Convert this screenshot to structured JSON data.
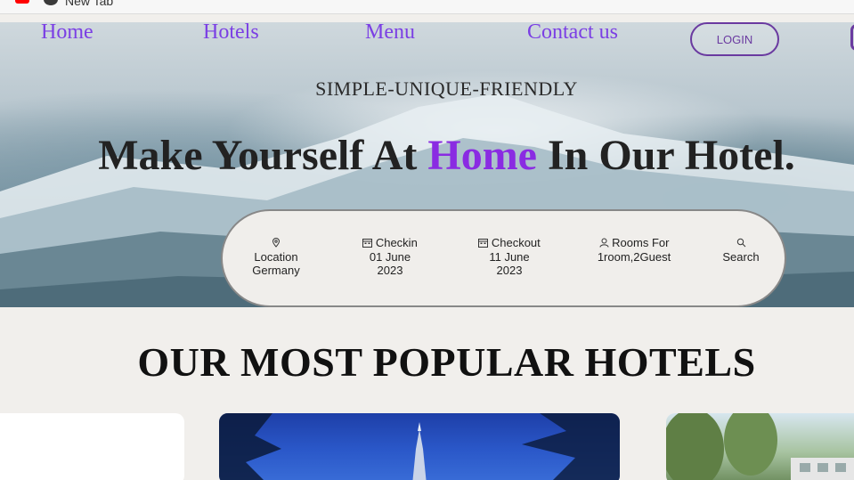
{
  "browser": {
    "tab_title": "New Tab"
  },
  "nav": {
    "links": [
      "Home",
      "Hotels",
      "Menu",
      "Contact us"
    ],
    "login_label": "LOGIN"
  },
  "hero": {
    "tagline": "SIMPLE-UNIQUE-FRIENDLY",
    "headline_before": "Make Yourself At ",
    "headline_accent": "Home",
    "headline_after": " In Our Hotel."
  },
  "search": {
    "location": {
      "label": "Location",
      "value": "Germany",
      "icon": "location-pin-icon"
    },
    "checkin": {
      "label": "Checkin",
      "date": "01 June",
      "year": "2023",
      "icon": "calendar-icon"
    },
    "checkout": {
      "label": "Checkout",
      "date": "11 June",
      "year": "2023",
      "icon": "calendar-icon"
    },
    "rooms": {
      "label": "Rooms For",
      "value": "1room,2Guest",
      "icon": "user-icon"
    },
    "search_label": "Search"
  },
  "section": {
    "title": "OUR MOST POPULAR HOTELS"
  },
  "colors": {
    "accent": "#8a2be2",
    "nav_link": "#7b3fe4",
    "login_border": "#6a3aa0"
  }
}
